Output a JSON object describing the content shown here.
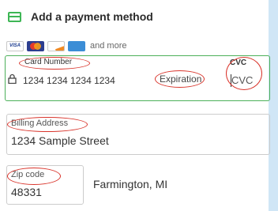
{
  "header": {
    "title": "Add a payment method",
    "icon": "credit-card-icon"
  },
  "brands": {
    "logos": [
      "visa",
      "mastercard",
      "discover",
      "amex"
    ],
    "visa_text": "VISA",
    "more_text": "and more"
  },
  "card": {
    "number_label": "Card Number",
    "number_placeholder": "1234 1234 1234 1234",
    "expiration_placeholder": "Expiration",
    "cvc_label": "CVC",
    "cvc_placeholder": "CVC"
  },
  "billing": {
    "label": "Billing Address",
    "value": "1234 Sample Street"
  },
  "zip": {
    "label": "Zip code",
    "value": "48331",
    "city_state": "Farmington, MI"
  },
  "colors": {
    "accent": "#3eb655",
    "annotation": "#d9342b",
    "background": "#d9ecfa"
  }
}
